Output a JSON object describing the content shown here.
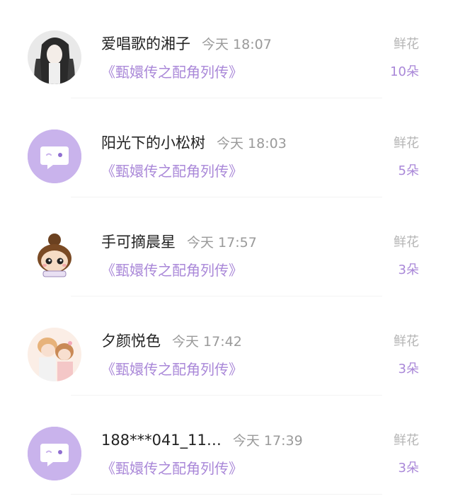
{
  "rows": [
    {
      "name": "爱唱歌的湘子",
      "time": "今天 18:07",
      "book": "《甄嬛传之配角列传》",
      "gift_label": "鲜花",
      "gift_count": "10朵",
      "avatar": "portrait-avatar"
    },
    {
      "name": "阳光下的小松树",
      "time": "今天 18:03",
      "book": "《甄嬛传之配角列传》",
      "gift_label": "鲜花",
      "gift_count": "5朵",
      "avatar": "default-chat-avatar"
    },
    {
      "name": "手可摘晨星",
      "time": "今天 17:57",
      "book": "《甄嬛传之配角列传》",
      "gift_label": "鲜花",
      "gift_count": "3朵",
      "avatar": "cartoon-girl-avatar"
    },
    {
      "name": "夕颜悦色",
      "time": "今天 17:42",
      "book": "《甄嬛传之配角列传》",
      "gift_label": "鲜花",
      "gift_count": "3朵",
      "avatar": "anime-couple-avatar"
    },
    {
      "name": "188***041_11…",
      "time": "今天 17:39",
      "book": "《甄嬛传之配角列传》",
      "gift_label": "鲜花",
      "gift_count": "3朵",
      "avatar": "default-chat-avatar"
    }
  ],
  "colors": {
    "accent": "#a987d8",
    "avatar_default_bg": "#c9b3ec",
    "name_text": "#222222",
    "muted_text": "#9a9a9a"
  }
}
